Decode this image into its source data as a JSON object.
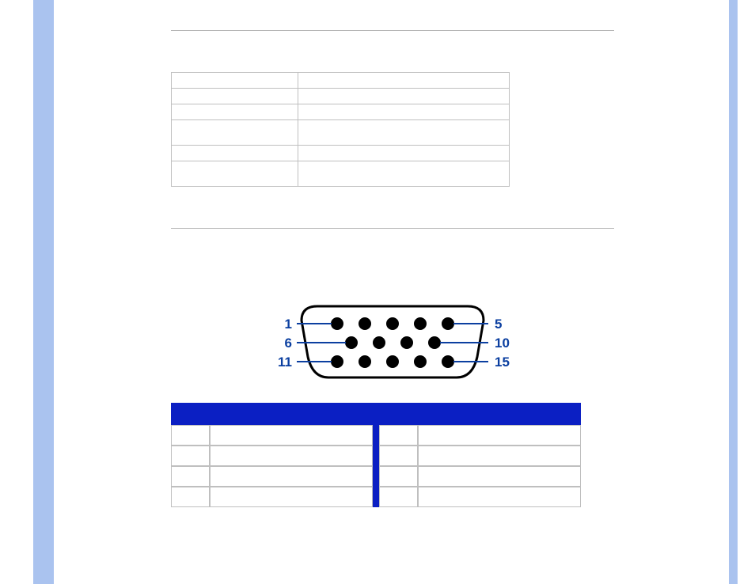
{
  "connector": {
    "labels": [
      "1",
      "5",
      "6",
      "10",
      "11",
      "15"
    ]
  },
  "spec_table": {
    "rows": [
      {
        "c1": "",
        "c2": ""
      },
      {
        "c1": "",
        "c2": ""
      },
      {
        "c1": "",
        "c2": ""
      },
      {
        "c1": "",
        "c2": "",
        "spacer": true
      },
      {
        "c1": "",
        "c2": ""
      },
      {
        "c1": "",
        "c2": "",
        "spacer": true
      }
    ]
  },
  "pins_table": {
    "left": [
      {
        "pin": "",
        "sig": ""
      },
      {
        "pin": "",
        "sig": ""
      },
      {
        "pin": "",
        "sig": ""
      },
      {
        "pin": "",
        "sig": ""
      }
    ],
    "right": [
      {
        "pin": "",
        "sig": ""
      },
      {
        "pin": "",
        "sig": ""
      },
      {
        "pin": "",
        "sig": ""
      },
      {
        "pin": "",
        "sig": ""
      }
    ]
  }
}
